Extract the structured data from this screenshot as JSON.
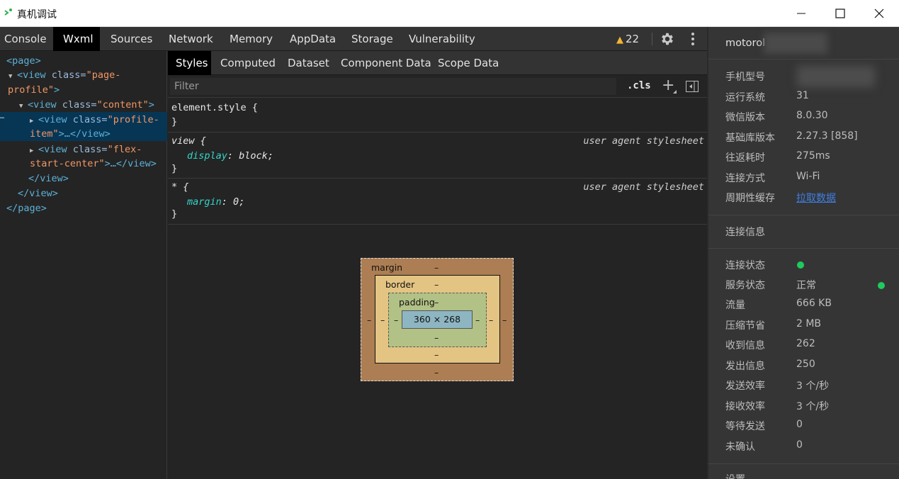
{
  "window": {
    "title": "真机调试",
    "min_label": "—",
    "max_label": "□",
    "close_label": "✕"
  },
  "main_tabs": [
    {
      "label": "Console",
      "active": false
    },
    {
      "label": "Wxml",
      "active": true
    },
    {
      "label": "Sources",
      "active": false
    },
    {
      "label": "Network",
      "active": false
    },
    {
      "label": "Memory",
      "active": false
    },
    {
      "label": "AppData",
      "active": false
    },
    {
      "label": "Storage",
      "active": false
    },
    {
      "label": "Vulnerability",
      "active": false
    }
  ],
  "warnings": {
    "count": "22",
    "color": "#f2b533"
  },
  "wxml_tree": {
    "page_open": "<page>",
    "view1_tag": "<view ",
    "view1_attr": "class=",
    "view1_val_a": "\"page-",
    "view1_val_b": "profile\"",
    "view1_close": ">",
    "view2_tag": "<view ",
    "view2_attr": "class=",
    "view2_val": "\"content\"",
    "view2_close": ">",
    "view3_tag": "<view ",
    "view3_attr": "class=",
    "view3_val_a": "\"profile-",
    "view3_val_b": "item\"",
    "view3_rest": ">…</view>",
    "view4_tag": "<view ",
    "view4_attr": "class=",
    "view4_val_a": "\"flex-",
    "view4_val_b": "start-center\"",
    "view4_rest": ">…</view>",
    "view_close_1": "</view>",
    "view_close_2": "</view>",
    "page_close": "</page>",
    "selection_marker": "…"
  },
  "sub_tabs": [
    {
      "label": "Styles",
      "active": true
    },
    {
      "label": "Computed",
      "active": false
    },
    {
      "label": "Dataset",
      "active": false
    },
    {
      "label": "Component Data",
      "active": false
    },
    {
      "label": "Scope Data",
      "active": false
    }
  ],
  "filter": {
    "placeholder": "Filter",
    "value": ""
  },
  "toolbar": {
    "cls_label": ".cls",
    "plus_label": "+"
  },
  "rules": {
    "element_style": {
      "selector": "element.style {",
      "close": "}"
    },
    "view": {
      "selector": "view {",
      "origin": "user agent stylesheet",
      "prop": "display",
      "value": "block",
      "close": "}"
    },
    "star": {
      "selector": "* {",
      "origin": "user agent stylesheet",
      "prop": "margin",
      "value": "0",
      "close": "}"
    }
  },
  "box_model": {
    "margin_label": "margin",
    "border_label": "border",
    "padding_label": "padding",
    "content_size": "360 × 268",
    "dash": "–",
    "colors": {
      "margin": "#ad7e53",
      "border": "#e4c483",
      "padding": "#b2c185",
      "content": "#8eb6c2"
    }
  },
  "device": {
    "name": "motorol",
    "info": [
      {
        "key": "手机型号",
        "value": ""
      },
      {
        "key": "运行系统",
        "value": "31"
      },
      {
        "key": "微信版本",
        "value": "8.0.30"
      },
      {
        "key": "基础库版本",
        "value": "2.27.3 [858]"
      },
      {
        "key": "往返耗时",
        "value": "275ms"
      },
      {
        "key": "连接方式",
        "value": "Wi-Fi"
      },
      {
        "key": "周期性缓存",
        "value": "拉取数据"
      }
    ],
    "section_connection": "连接信息",
    "conn": [
      {
        "key": "连接状态",
        "value": ""
      },
      {
        "key": "服务状态",
        "value": "正常"
      },
      {
        "key": "流量",
        "value": "666 KB"
      },
      {
        "key": "压缩节省",
        "value": "2 MB"
      },
      {
        "key": "收到信息",
        "value": "262"
      },
      {
        "key": "发出信息",
        "value": "250"
      },
      {
        "key": "发送效率",
        "value": "3 个/秒"
      },
      {
        "key": "接收效率",
        "value": "3 个/秒"
      },
      {
        "key": "等待发送",
        "value": "0"
      },
      {
        "key": "未确认",
        "value": "0"
      }
    ],
    "section_settings": "设置",
    "status_color": "#1fcb5e",
    "link_color": "#3f7fe3"
  }
}
